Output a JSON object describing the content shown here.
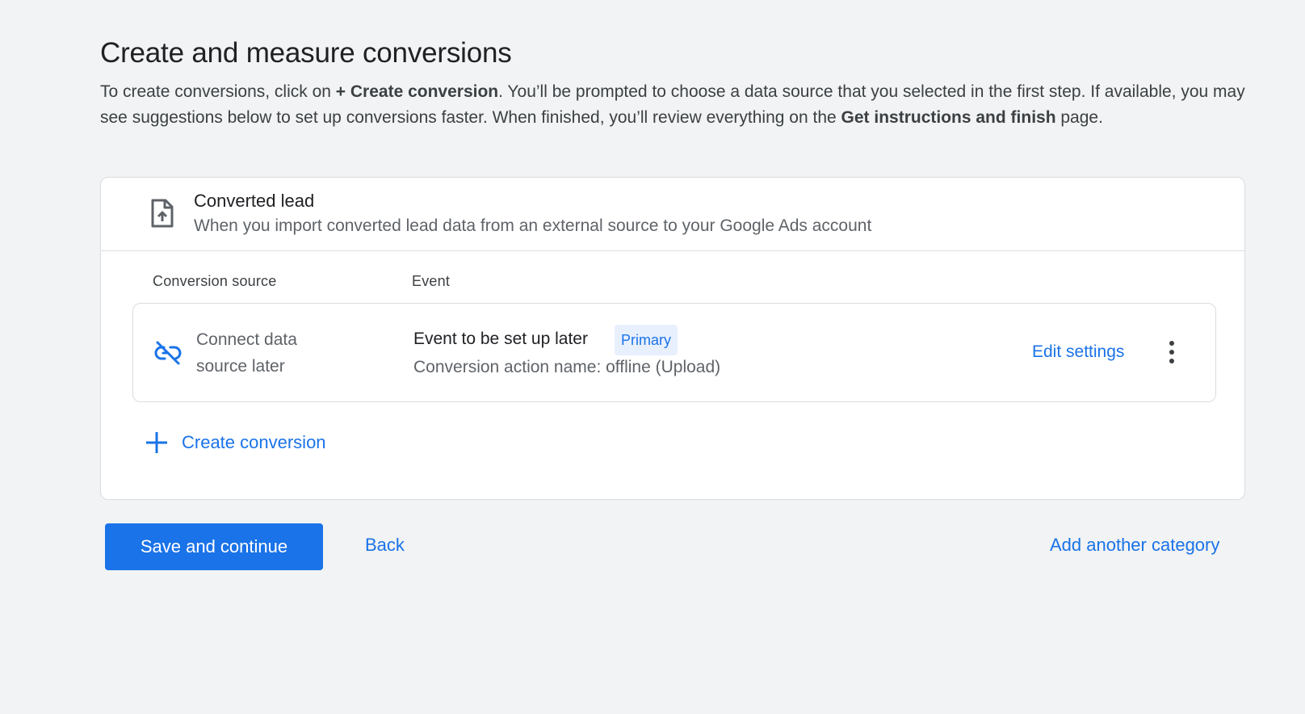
{
  "page": {
    "title": "Create and measure conversions",
    "intro": {
      "p1": "To create conversions, click on ",
      "bold1": "+ Create conversion",
      "p2": ". You’ll be prompted to choose a data source that you selected in the first step. If available, you may see suggestions below to set up conversions faster. When finished, you’ll review everything on the ",
      "bold2": "Get instructions and finish",
      "p3": " page."
    }
  },
  "card": {
    "icon": "file-upload-icon",
    "title": "Converted lead",
    "subtitle": "When you import converted lead data from an external source to your Google Ads account",
    "columns": {
      "source": "Conversion source",
      "event": "Event"
    },
    "row": {
      "source_icon": "link-off-icon",
      "source_label": "Connect data source later",
      "event_title": "Event to be set up later",
      "badge": "Primary",
      "event_detail": "Conversion action name: offline (Upload)",
      "edit_label": "Edit settings",
      "more_icon": "more-vertical-icon"
    },
    "create_label": "Create conversion",
    "create_icon": "plus-icon"
  },
  "actions": {
    "save_label": "Save and continue",
    "back_label": "Back",
    "add_category_label": "Add another category"
  },
  "colors": {
    "accent": "#1a73e8",
    "background": "#f1f3f4",
    "badge_bg": "#e8f0fe"
  }
}
